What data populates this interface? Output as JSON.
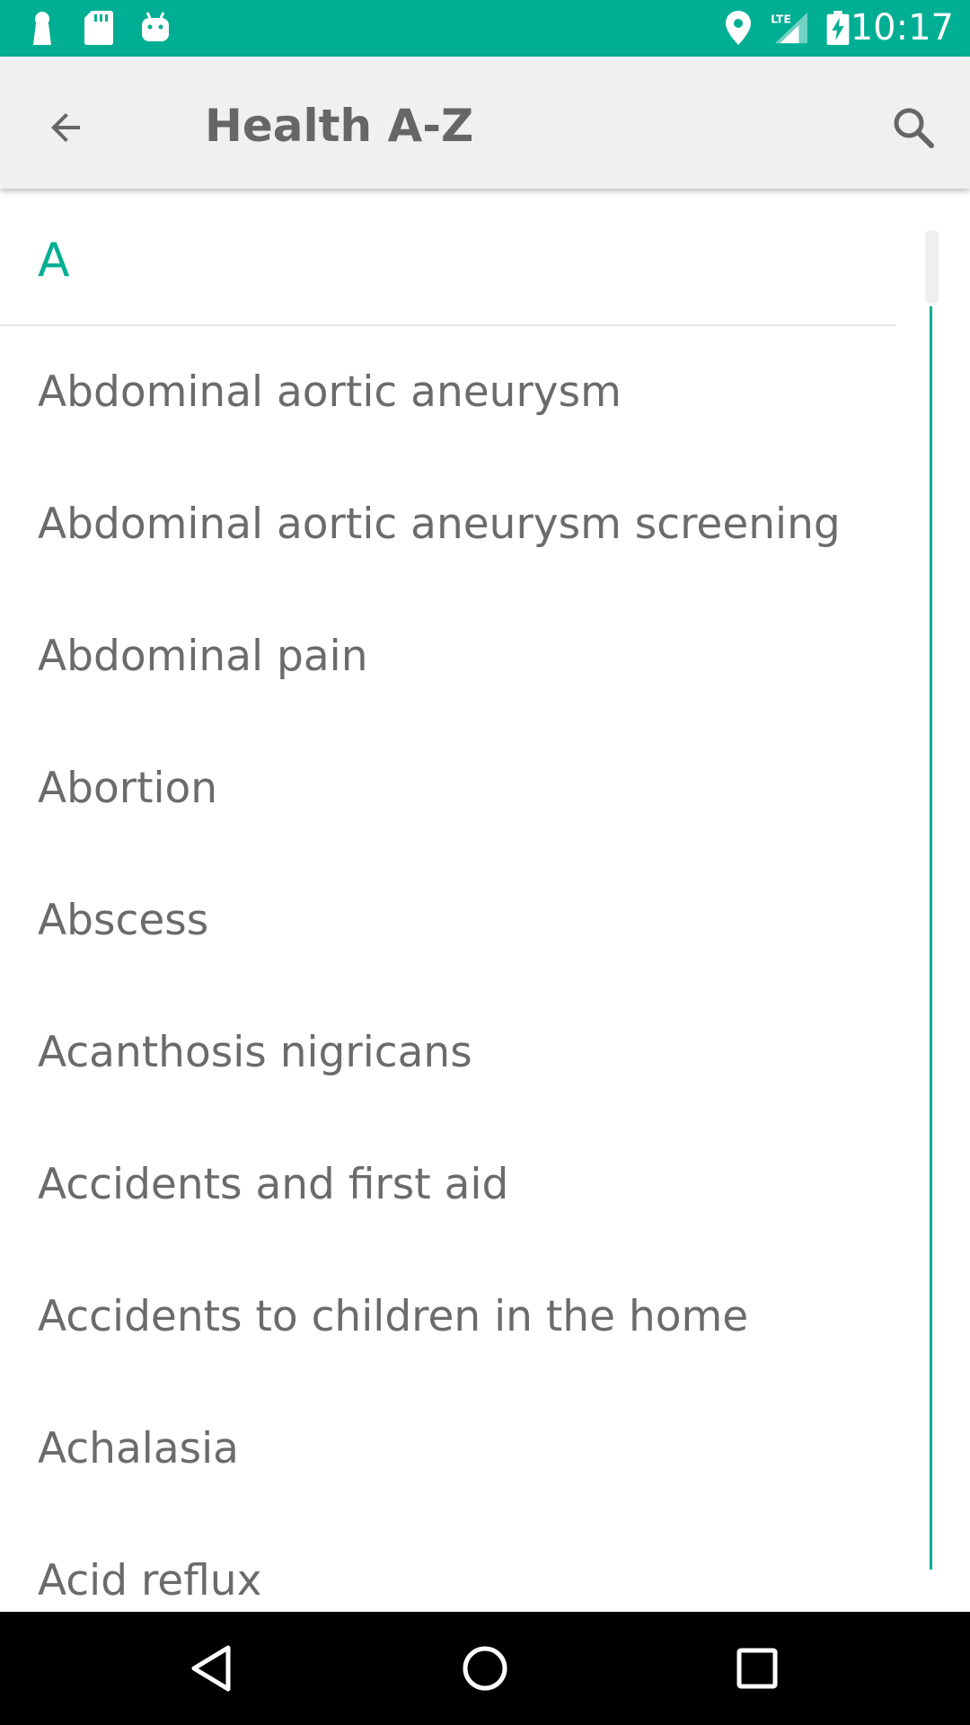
{
  "status_bar": {
    "time": "10:17",
    "background_color": "#00AE93",
    "left_icons": [
      "person-notification-icon",
      "sd-card-icon",
      "android-icon"
    ],
    "right_icons": [
      "location-icon",
      "lte-signal-icon",
      "battery-charging-icon"
    ],
    "network_label": "LTE"
  },
  "app_bar": {
    "title": "Health A-Z",
    "back_icon": "arrow-back-icon",
    "search_icon": "search-icon"
  },
  "list": {
    "section_letter": "A",
    "items": [
      {
        "label": "Abdominal aortic aneurysm"
      },
      {
        "label": "Abdominal aortic aneurysm screening"
      },
      {
        "label": "Abdominal pain"
      },
      {
        "label": "Abortion"
      },
      {
        "label": "Abscess"
      },
      {
        "label": "Acanthosis nigricans"
      },
      {
        "label": "Accidents and first aid"
      },
      {
        "label": "Accidents to children in the home"
      },
      {
        "label": "Achalasia"
      },
      {
        "label": "Acid reflux"
      }
    ]
  },
  "colors": {
    "accent": "#00AE93",
    "text": "#6B6B6B",
    "title": "#666666",
    "app_bar_bg": "#F0F0F0"
  },
  "nav_bar": {
    "icons": [
      "nav-back-icon",
      "nav-home-icon",
      "nav-recents-icon"
    ]
  }
}
